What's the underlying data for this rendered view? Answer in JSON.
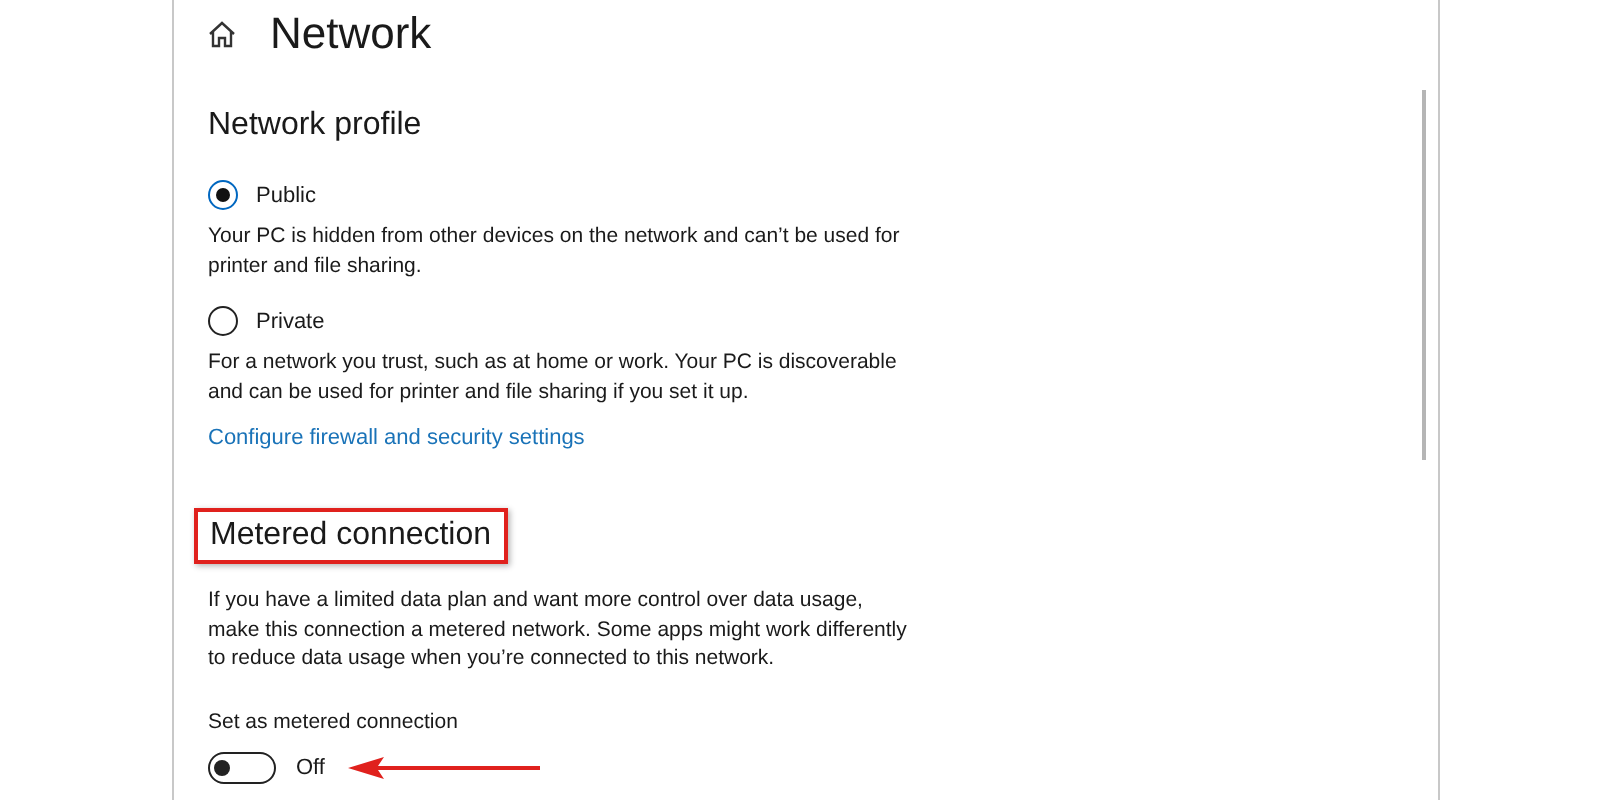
{
  "page": {
    "title": "Network"
  },
  "network_profile": {
    "heading": "Network profile",
    "options": [
      {
        "label": "Public",
        "selected": true,
        "description": "Your PC is hidden from other devices on the network and can’t be used for printer and file sharing."
      },
      {
        "label": "Private",
        "selected": false,
        "description": "For a network you trust, such as at home or work. Your PC is discoverable and can be used for printer and file sharing if you set it up."
      }
    ],
    "link": "Configure firewall and security settings"
  },
  "metered_connection": {
    "heading": "Metered connection",
    "highlighted": true,
    "description": "If you have a limited data plan and want more control over data usage, make this connection a metered network. Some apps might work differently to reduce data usage when you’re connected to this network.",
    "toggle_label": "Set as metered connection",
    "toggle": {
      "on": false,
      "state_text": "Off",
      "arrow": true
    }
  }
}
